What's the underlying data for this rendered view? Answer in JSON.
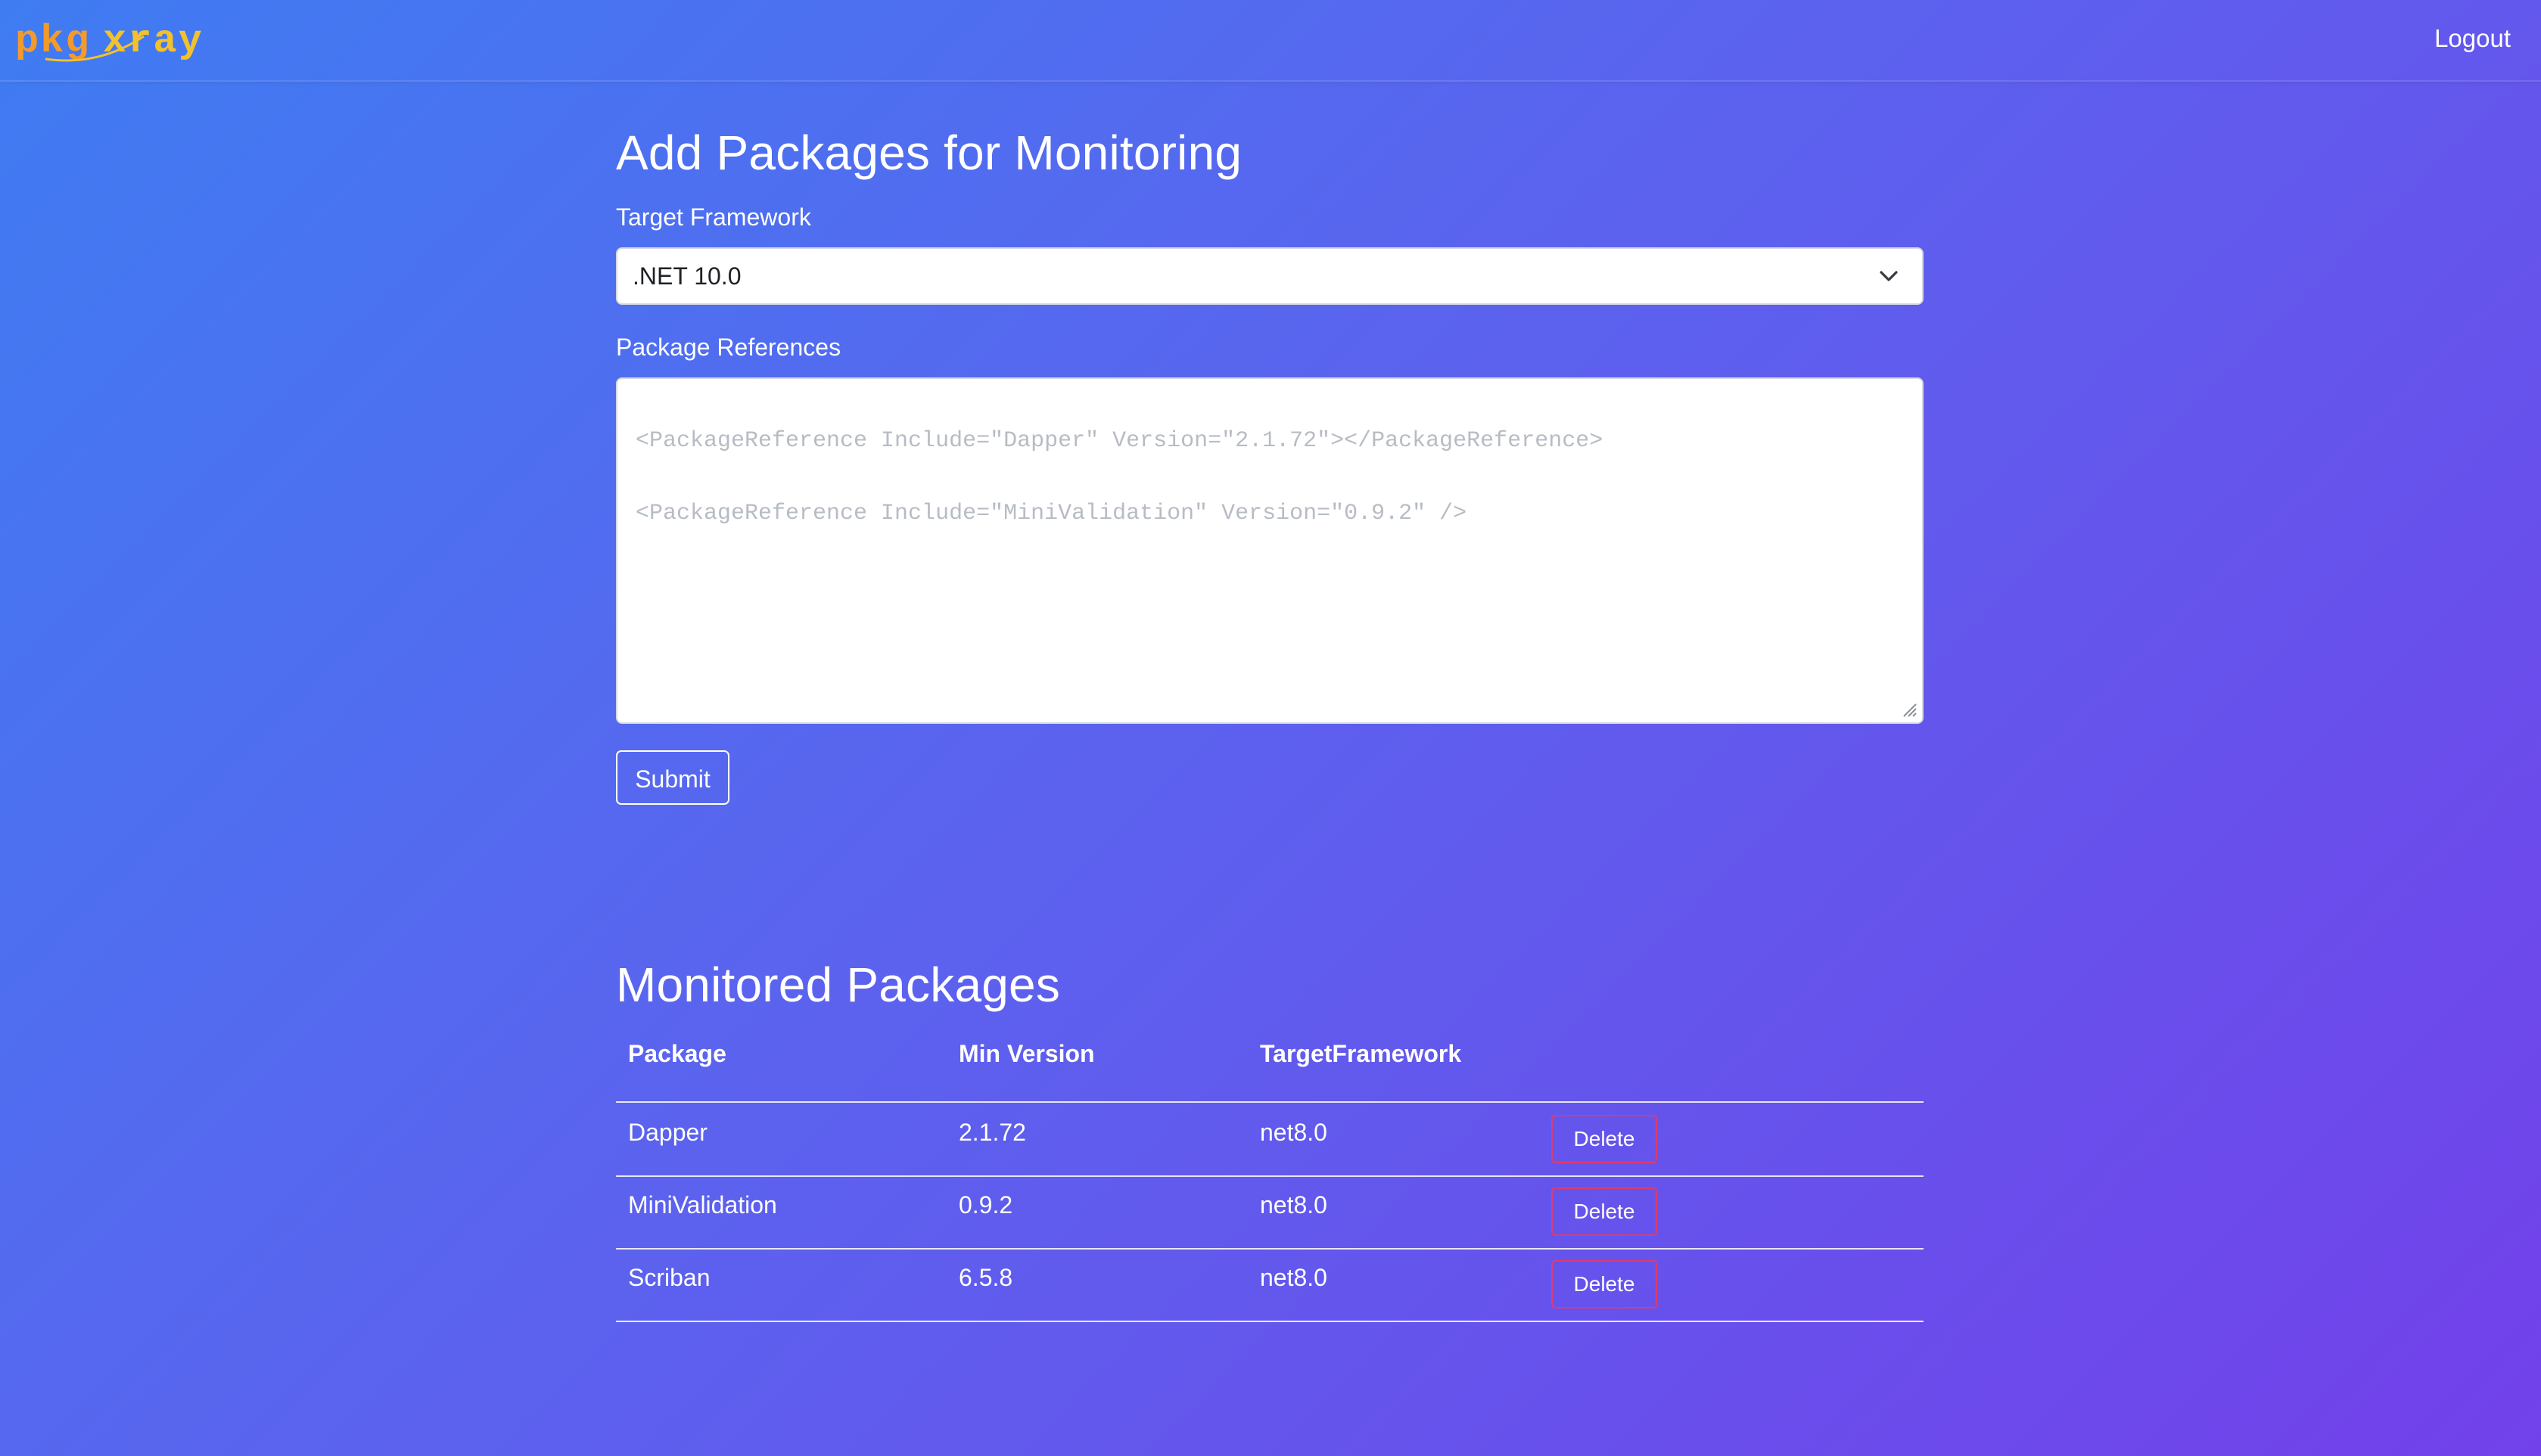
{
  "navbar": {
    "brand": "pkgxray",
    "logout_label": "Logout"
  },
  "form": {
    "title": "Add Packages for Monitoring",
    "framework_label": "Target Framework",
    "framework_selected": ".NET 10.0",
    "references_label": "Package References",
    "references_placeholder_lines": [
      "<PackageReference Include=\"Dapper\" Version=\"2.1.72\"></PackageReference>",
      "<PackageReference Include=\"MiniValidation\" Version=\"0.9.2\" />"
    ],
    "submit_label": "Submit"
  },
  "monitored": {
    "title": "Monitored Packages",
    "columns": [
      "Package",
      "Min Version",
      "TargetFramework"
    ],
    "rows": [
      {
        "package": "Dapper",
        "min_version": "2.1.72",
        "target_framework": "net8.0",
        "action": "Delete"
      },
      {
        "package": "MiniValidation",
        "min_version": "0.9.2",
        "target_framework": "net8.0",
        "action": "Delete"
      },
      {
        "package": "Scriban",
        "min_version": "6.5.8",
        "target_framework": "net8.0",
        "action": "Delete"
      }
    ]
  },
  "colors": {
    "gradient_start": "#3f7cf2",
    "gradient_end": "#7241ea",
    "brand_orange": "#f39a2b",
    "brand_yellow": "#f2c12e",
    "delete_border": "#dc3c70"
  },
  "icons": {
    "select_chevron": "chevron-down-icon",
    "textarea_resize": "resize-handle-icon"
  }
}
